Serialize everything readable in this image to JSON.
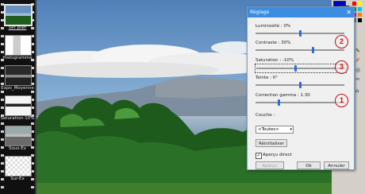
{
  "filmstrip": {
    "items": [
      {
        "label": "Ser plan",
        "selected": true
      },
      {
        "label": "Histogramme",
        "selected": false
      },
      {
        "label": "Expo_Moyenne",
        "selected": false
      },
      {
        "label": "Saturation-10%",
        "selected": false
      },
      {
        "label": "Sous-Ex",
        "selected": false
      },
      {
        "label": "Sur-Ex",
        "selected": false
      }
    ]
  },
  "dialog": {
    "title": "Réglage",
    "close_icon": "close-icon",
    "luminosity": {
      "label": "Luminosité : 0%",
      "value": 0
    },
    "contrast": {
      "label": "Contraste : 30%",
      "value": 30
    },
    "saturation": {
      "label": "Saturation : -10%",
      "value": -10
    },
    "hue": {
      "label": "Teinte : 0°",
      "value": 0
    },
    "gamma": {
      "label": "Correction gamma : 1.30",
      "value": 1.3
    },
    "layer": {
      "label": "Couche :",
      "selected": "<Toutes>"
    },
    "reset_label": "Réinitialiser",
    "preview": {
      "label": "Aperçu direct",
      "checked": true
    },
    "apply_label": "Aperçu",
    "ok_label": "Ok",
    "cancel_label": "Annuler"
  },
  "annotations": [
    "2",
    "3",
    "1"
  ],
  "colors": {
    "titlebar": "#3a8de0",
    "annotation": "#c01010",
    "slider_knob": "#2a6dd6"
  }
}
